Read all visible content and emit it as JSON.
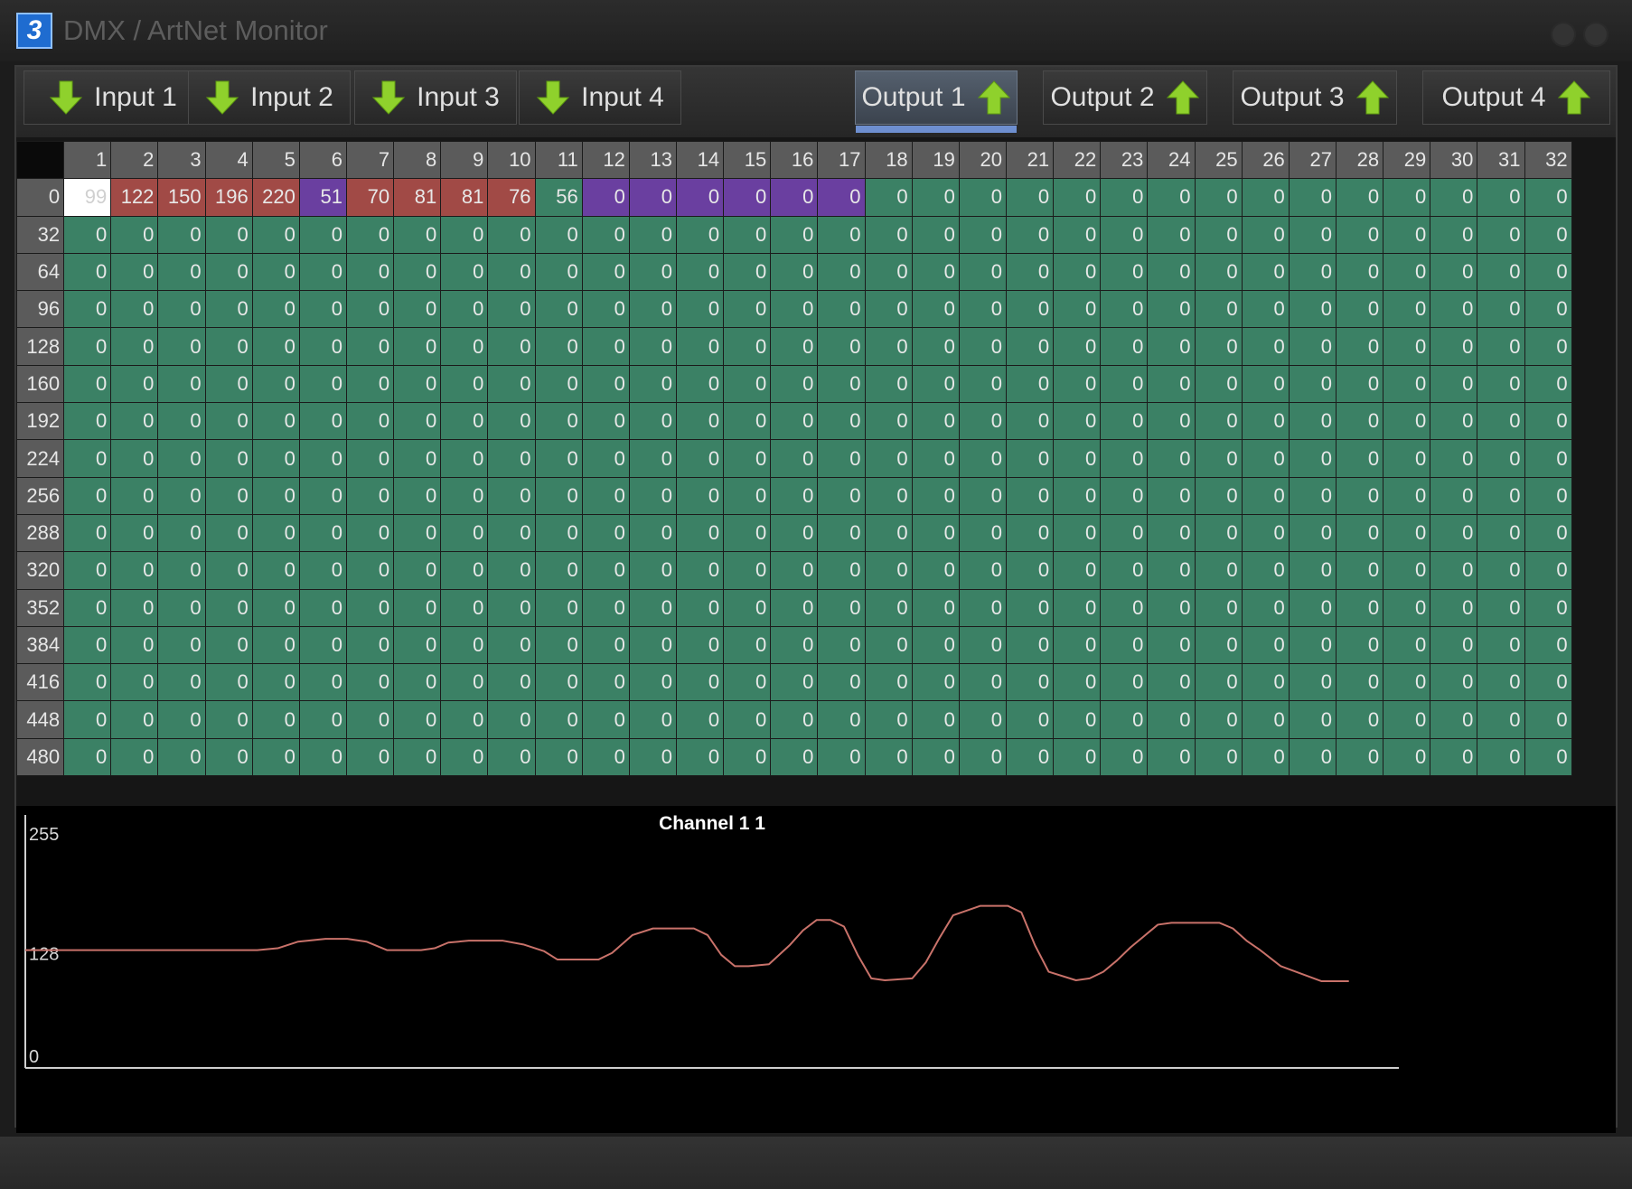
{
  "window": {
    "title": "DMX / ArtNet Monitor",
    "icon": "app-logo-icon"
  },
  "tabs": [
    {
      "label": "Input 1",
      "icon": "arrow-down-icon",
      "active": false
    },
    {
      "label": "Input 2",
      "icon": "arrow-down-icon",
      "active": false
    },
    {
      "label": "Input 3",
      "icon": "arrow-down-icon",
      "active": false
    },
    {
      "label": "Input 4",
      "icon": "arrow-down-icon",
      "active": false
    },
    {
      "label": "Output 1",
      "icon": "arrow-up-icon",
      "active": true
    },
    {
      "label": "Output 2",
      "icon": "arrow-up-icon",
      "active": false
    },
    {
      "label": "Output 3",
      "icon": "arrow-up-icon",
      "active": false
    },
    {
      "label": "Output 4",
      "icon": "arrow-up-icon",
      "active": false
    }
  ],
  "grid": {
    "columns": [
      "1",
      "2",
      "3",
      "4",
      "5",
      "6",
      "7",
      "8",
      "9",
      "10",
      "11",
      "12",
      "13",
      "14",
      "15",
      "16",
      "17",
      "18",
      "19",
      "20",
      "21",
      "22",
      "23",
      "24",
      "25",
      "26",
      "27",
      "28",
      "29",
      "30",
      "31",
      "32"
    ],
    "row_headers": [
      "0",
      "32",
      "64",
      "96",
      "128",
      "160",
      "192",
      "224",
      "256",
      "288",
      "320",
      "352",
      "384",
      "416",
      "448",
      "480"
    ],
    "first_row_values": [
      "99",
      "122",
      "150",
      "196",
      "220",
      "51",
      "70",
      "81",
      "81",
      "76",
      "56",
      "0",
      "0",
      "0",
      "0",
      "0",
      "0",
      "0",
      "0",
      "0",
      "0",
      "0",
      "0",
      "0",
      "0",
      "0",
      "0",
      "0",
      "0",
      "0",
      "0",
      "0"
    ],
    "first_row_colors": [
      "white",
      "red",
      "red",
      "red",
      "red",
      "purple",
      "red",
      "red",
      "red",
      "red",
      "teal",
      "purple",
      "purple",
      "purple",
      "purple",
      "purple",
      "purple",
      "teal",
      "teal",
      "teal",
      "teal",
      "teal",
      "teal",
      "teal",
      "teal",
      "teal",
      "teal",
      "teal",
      "teal",
      "teal",
      "teal",
      "teal"
    ],
    "default_value": "0",
    "colors": {
      "teal": "#3b8165",
      "red": "#a14a46",
      "purple": "#6a3fa0",
      "white": "#ffffff",
      "header": "#5b5b5b"
    }
  },
  "chart_data": {
    "type": "line",
    "title": "Channel 1  1",
    "y_ticks": [
      "255",
      "128",
      "0"
    ],
    "ylim": [
      0,
      255
    ],
    "xlim": [
      0,
      100
    ],
    "line_color": "#c9726a",
    "series": [
      {
        "x": [
          0,
          17,
          18.5,
          20,
          22,
          23.6,
          25,
          26.5,
          29,
          30,
          31,
          32.5,
          35,
          36.5,
          38,
          39,
          41,
          42,
          43,
          44.5,
          46,
          47.5,
          49,
          50,
          51,
          52,
          53,
          54.5,
          56,
          57,
          58,
          59,
          60,
          61,
          62,
          63,
          65,
          66,
          67,
          68,
          70,
          71,
          72,
          73,
          74,
          75,
          77,
          78,
          79,
          80,
          81,
          82,
          83,
          84,
          85,
          86,
          87.5,
          88.5,
          89.5,
          90.5,
          92,
          93.5,
          95,
          96,
          97
        ],
        "y": [
          125,
          125,
          127,
          134,
          137,
          137,
          134,
          125,
          125,
          127,
          133,
          135,
          135,
          131,
          124,
          115,
          115,
          115,
          122,
          141,
          148,
          148,
          148,
          141,
          120,
          108,
          108,
          110,
          130,
          146,
          157,
          157,
          150,
          120,
          95,
          93,
          95,
          112,
          138,
          162,
          172,
          172,
          172,
          165,
          130,
          102,
          93,
          95,
          102,
          114,
          128,
          140,
          152,
          154,
          154,
          154,
          154,
          148,
          135,
          125,
          108,
          100,
          92,
          92,
          92
        ]
      }
    ]
  }
}
